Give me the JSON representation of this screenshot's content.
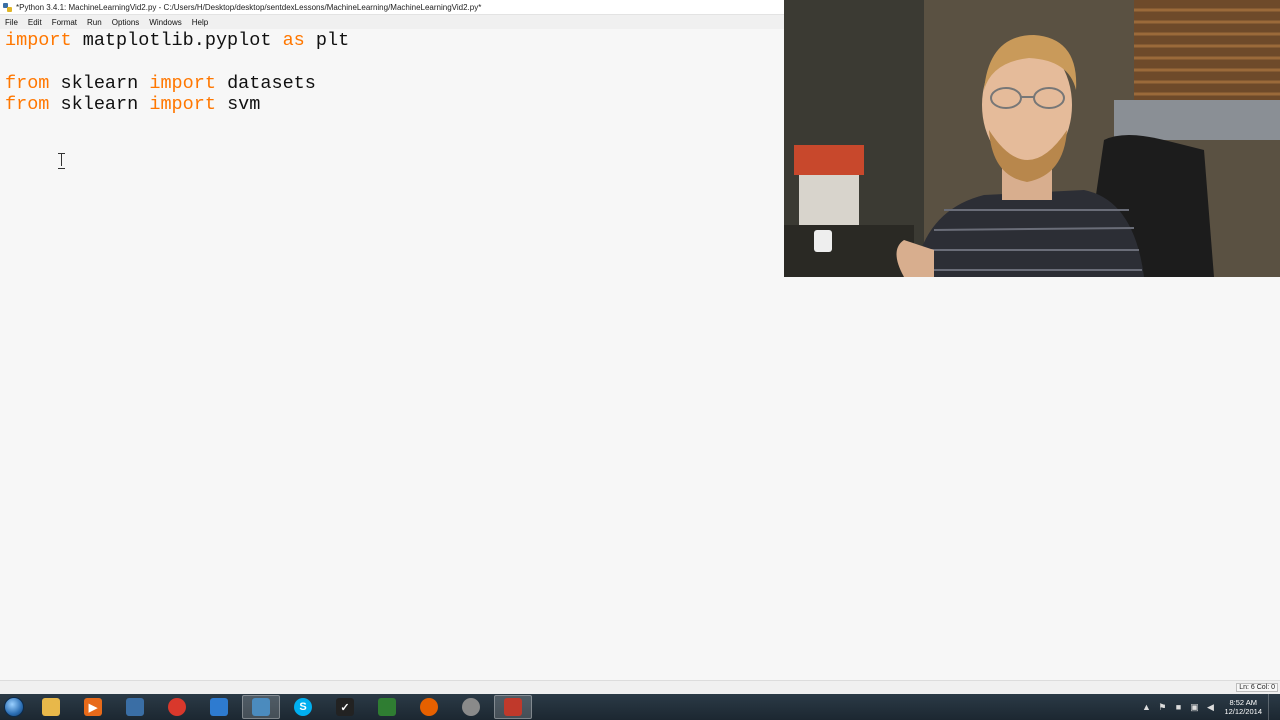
{
  "window": {
    "title": "*Python 3.4.1: MachineLearningVid2.py - C:/Users/H/Desktop/desktop/sentdexLessons/MachineLearning/MachineLearningVid2.py*"
  },
  "menu": [
    "File",
    "Edit",
    "Format",
    "Run",
    "Options",
    "Windows",
    "Help"
  ],
  "code": {
    "line1": {
      "kw1": "import",
      "rest1": " matplotlib.pyplot ",
      "kw2": "as",
      "rest2": " plt"
    },
    "line3": {
      "kw1": "from",
      "rest1": " sklearn ",
      "kw2": "import",
      "rest2": " datasets"
    },
    "line4": {
      "kw1": "from",
      "rest1": " sklearn ",
      "kw2": "import",
      "rest2": " svm"
    }
  },
  "status": {
    "position": "Ln: 6 Col: 0"
  },
  "taskbar": {
    "apps": [
      {
        "icon": "file-explorer-icon",
        "color": "#e8b84a"
      },
      {
        "icon": "media-player-icon",
        "color": "#e86a1a"
      },
      {
        "icon": "python-file-icon",
        "color": "#3a6ea5"
      },
      {
        "icon": "chrome-icon",
        "color": "#d9382c"
      },
      {
        "icon": "text-editor-icon",
        "color": "#2e7bd0"
      },
      {
        "icon": "python-idle-icon",
        "color": "#4b8bbe"
      },
      {
        "icon": "skype-icon",
        "color": "#00aff0"
      },
      {
        "icon": "inkscape-icon",
        "color": "#222222"
      },
      {
        "icon": "terminal-icon",
        "color": "#2f7d32"
      },
      {
        "icon": "firefox-icon",
        "color": "#e66000"
      },
      {
        "icon": "search-app-icon",
        "color": "#8a8a8a"
      },
      {
        "icon": "paint-app-icon",
        "color": "#c0392b"
      }
    ],
    "clock": {
      "time": "8:52 AM",
      "date": "12/12/2014"
    }
  },
  "colors": {
    "keyword": "#ff7700",
    "editor_bg": "#f7f7f7"
  }
}
